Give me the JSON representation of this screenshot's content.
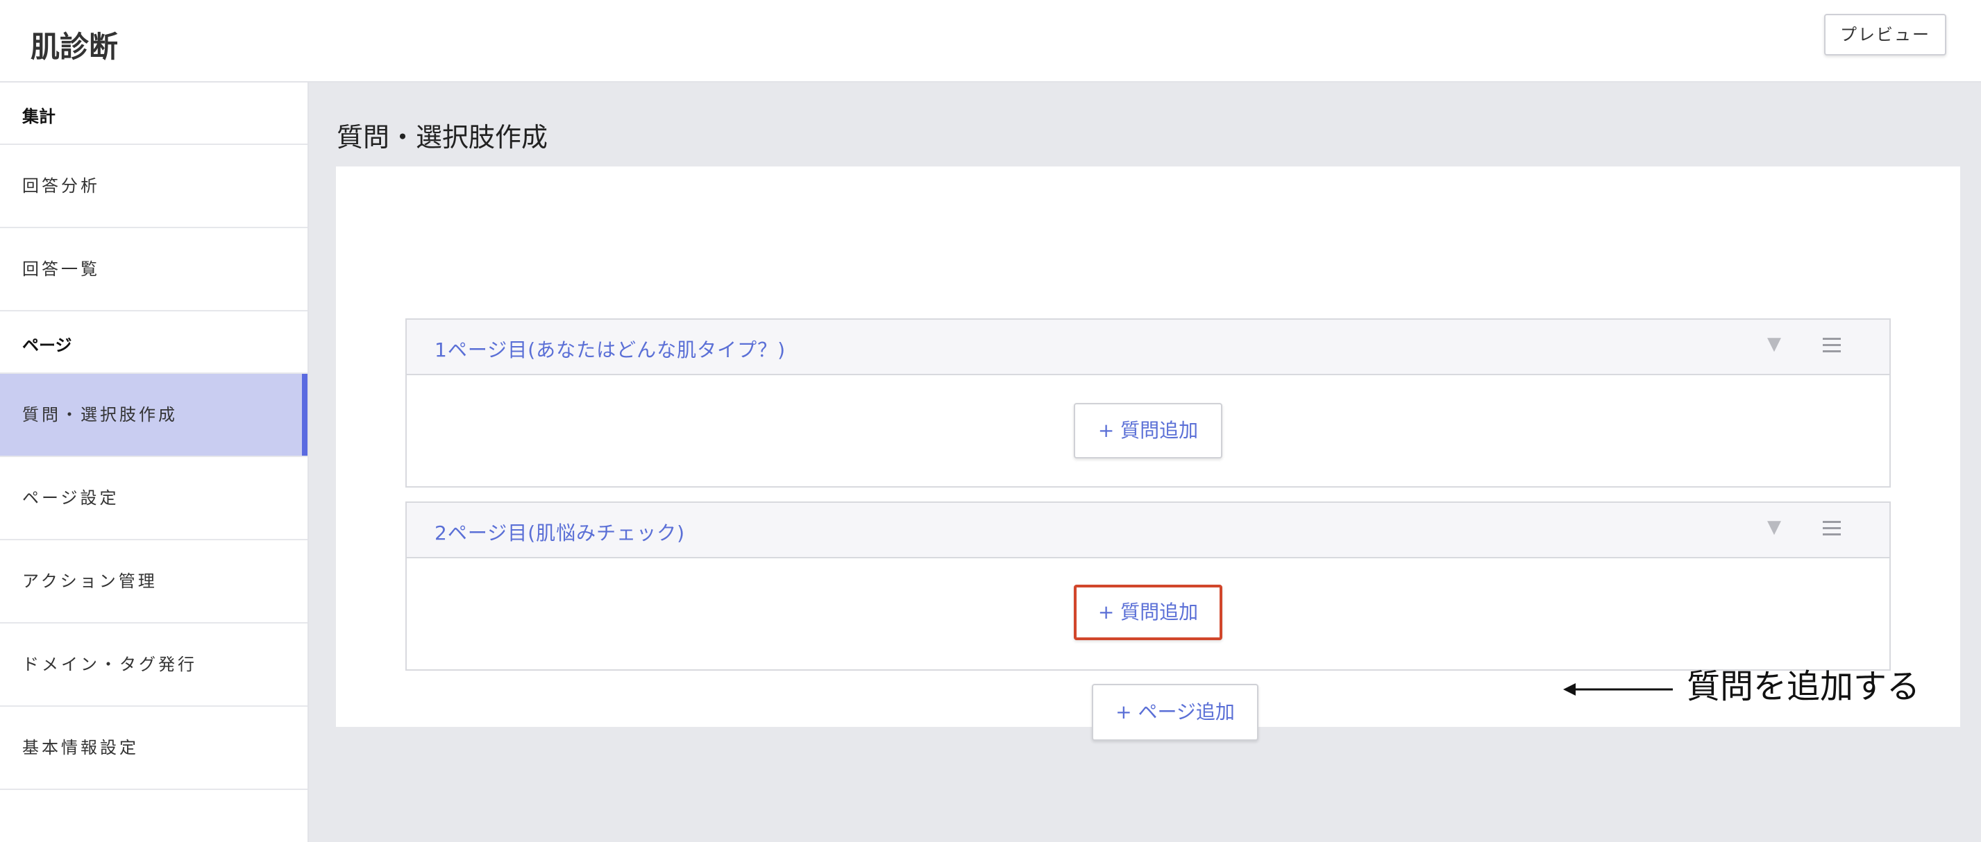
{
  "header": {
    "app_title": "肌診断",
    "preview_label": "プレビュー"
  },
  "sidebar": {
    "sections": [
      {
        "label": "集計",
        "items": [
          {
            "label": "回答分析"
          },
          {
            "label": "回答一覧"
          }
        ]
      },
      {
        "label": "ページ",
        "items": [
          {
            "label": "質問・選択肢作成",
            "active": true
          },
          {
            "label": "ページ設定"
          },
          {
            "label": "アクション管理"
          },
          {
            "label": "ドメイン・タグ発行"
          },
          {
            "label": "基本情報設定"
          }
        ]
      }
    ]
  },
  "main": {
    "heading": "質問・選択肢作成",
    "pages": [
      {
        "title": "1ページ目(あなたはどんな肌タイプ？)",
        "add_question_label": "+ 質問追加"
      },
      {
        "title": "2ページ目(肌悩みチェック)",
        "add_question_label": "+ 質問追加"
      }
    ],
    "add_page_label": "+ ページ追加"
  },
  "annotation": {
    "text": "質問を追加する"
  },
  "colors": {
    "accent": "#5a6fd6",
    "active_bg": "#c9cdf1",
    "active_bar": "#5a6ae0",
    "highlight": "#d1462b"
  },
  "icons": [
    "chevron-down-icon",
    "drag-handle-icon",
    "arrow-left-icon"
  ]
}
